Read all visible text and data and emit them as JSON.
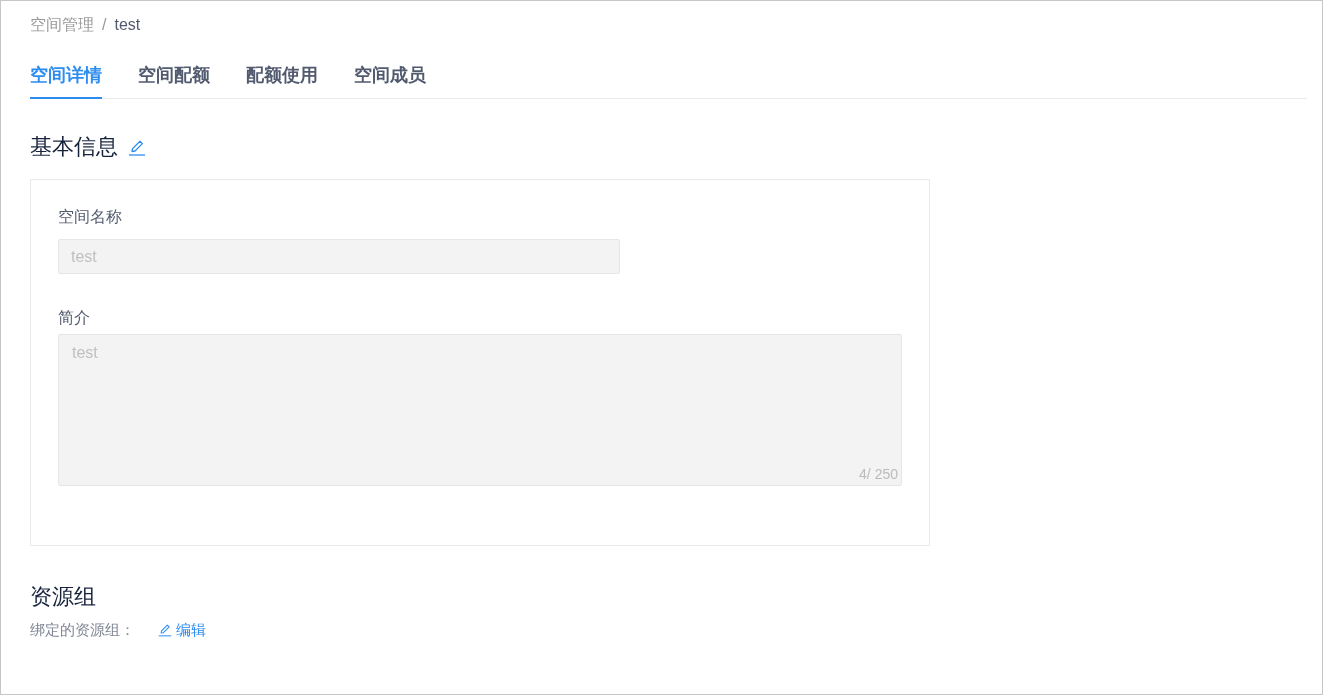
{
  "breadcrumb": {
    "separator": "/",
    "items": [
      {
        "label": "空间管理",
        "current": false
      },
      {
        "label": "test",
        "current": true
      }
    ]
  },
  "tabs": [
    {
      "label": "空间详情",
      "selected": true
    },
    {
      "label": "空间配额",
      "selected": false
    },
    {
      "label": "配额使用",
      "selected": false
    },
    {
      "label": "空间成员",
      "selected": false
    }
  ],
  "basic_info": {
    "title": "基本信息",
    "fields": [
      {
        "kind": "input",
        "label": "空间名称",
        "value": "test",
        "disabled": true
      },
      {
        "kind": "textarea",
        "label": "简介",
        "value": "test",
        "counter": "4/ 250",
        "disabled": true
      }
    ]
  },
  "resource_group": {
    "title": "资源组",
    "label": "绑定的资源组：",
    "edit_link": "编辑"
  }
}
